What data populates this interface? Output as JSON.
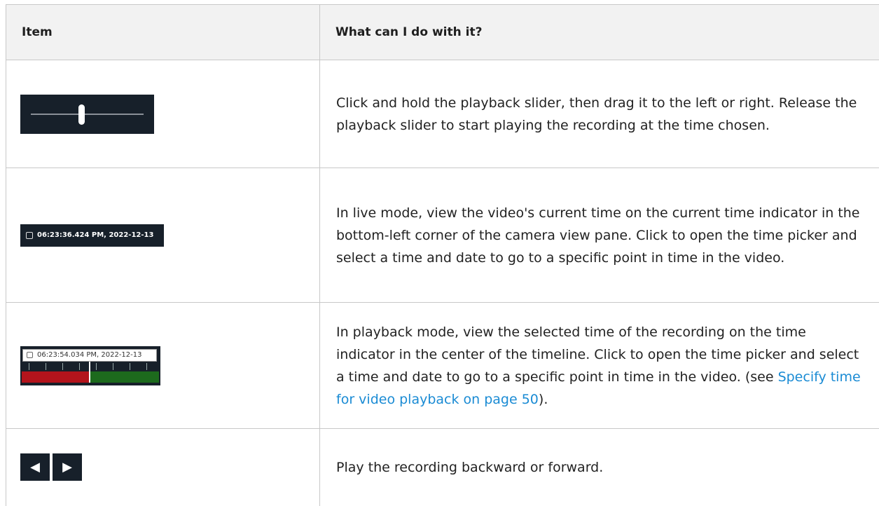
{
  "header": {
    "col1": "Item",
    "col2": "What can I do with it?"
  },
  "rows": [
    {
      "text": "Click and hold the playback slider, then drag it to the left or right. Release the playback slider to start playing the recording at the time chosen."
    },
    {
      "image_text": "06:23:36.424 PM, 2022-12-13",
      "text": "In live mode, view the video's current time on the current time indicator in the bottom-left corner of the camera view pane. Click to open the time picker and select a time and date to go to a specific point in time in the video."
    },
    {
      "image_text": "06:23:54.034 PM, 2022-12-13",
      "text_before": "In playback mode, view the selected time of the recording on the time indicator in the center of the timeline. Click to open the time picker and select a time and date to go to a specific point in time in the video. (see ",
      "link": "Specify time for video playback on page 50",
      "text_after": ")."
    },
    {
      "text": "Play the recording backward or forward."
    }
  ],
  "colors": {
    "link": "#1a8bd4",
    "chip_bg": "#17202a",
    "timeline_red": "#b3141c",
    "timeline_green": "#1d6a1d"
  },
  "icons": [
    "playback-slider-icon",
    "clock-icon",
    "backward-play-icon",
    "forward-play-icon"
  ]
}
